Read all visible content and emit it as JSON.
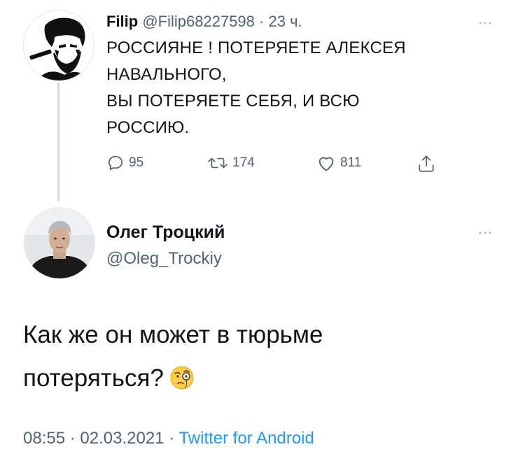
{
  "parent_tweet": {
    "name": "Filip",
    "handle": "@Filip68227598",
    "separator": "·",
    "time": "23 ч.",
    "text_lines": [
      "РОССИЯНЕ ! ПОТЕРЯЕТЕ АЛЕКСЕЯ",
      "НАВАЛЬНОГО,",
      "ВЫ ПОТЕРЯЕТЕ СЕБЯ, И ВСЮ",
      "РОССИЮ."
    ],
    "replies": "95",
    "retweets": "174",
    "likes": "811",
    "more": "···"
  },
  "main_tweet": {
    "name": "Олег Троцкий",
    "handle": "@Oleg_Trockiy",
    "more": "···",
    "text_lines": [
      "Как же он может в тюрьме",
      "потеряться?"
    ],
    "emoji": "face-with-monocle",
    "time": "08:55",
    "separator1": "·",
    "date": "02.03.2021",
    "separator2": "·",
    "client": "Twitter for Android"
  },
  "colors": {
    "text": "#0f1419",
    "secondary": "#536471",
    "link": "#1d9bf0",
    "thread_line": "#cfd9de"
  }
}
